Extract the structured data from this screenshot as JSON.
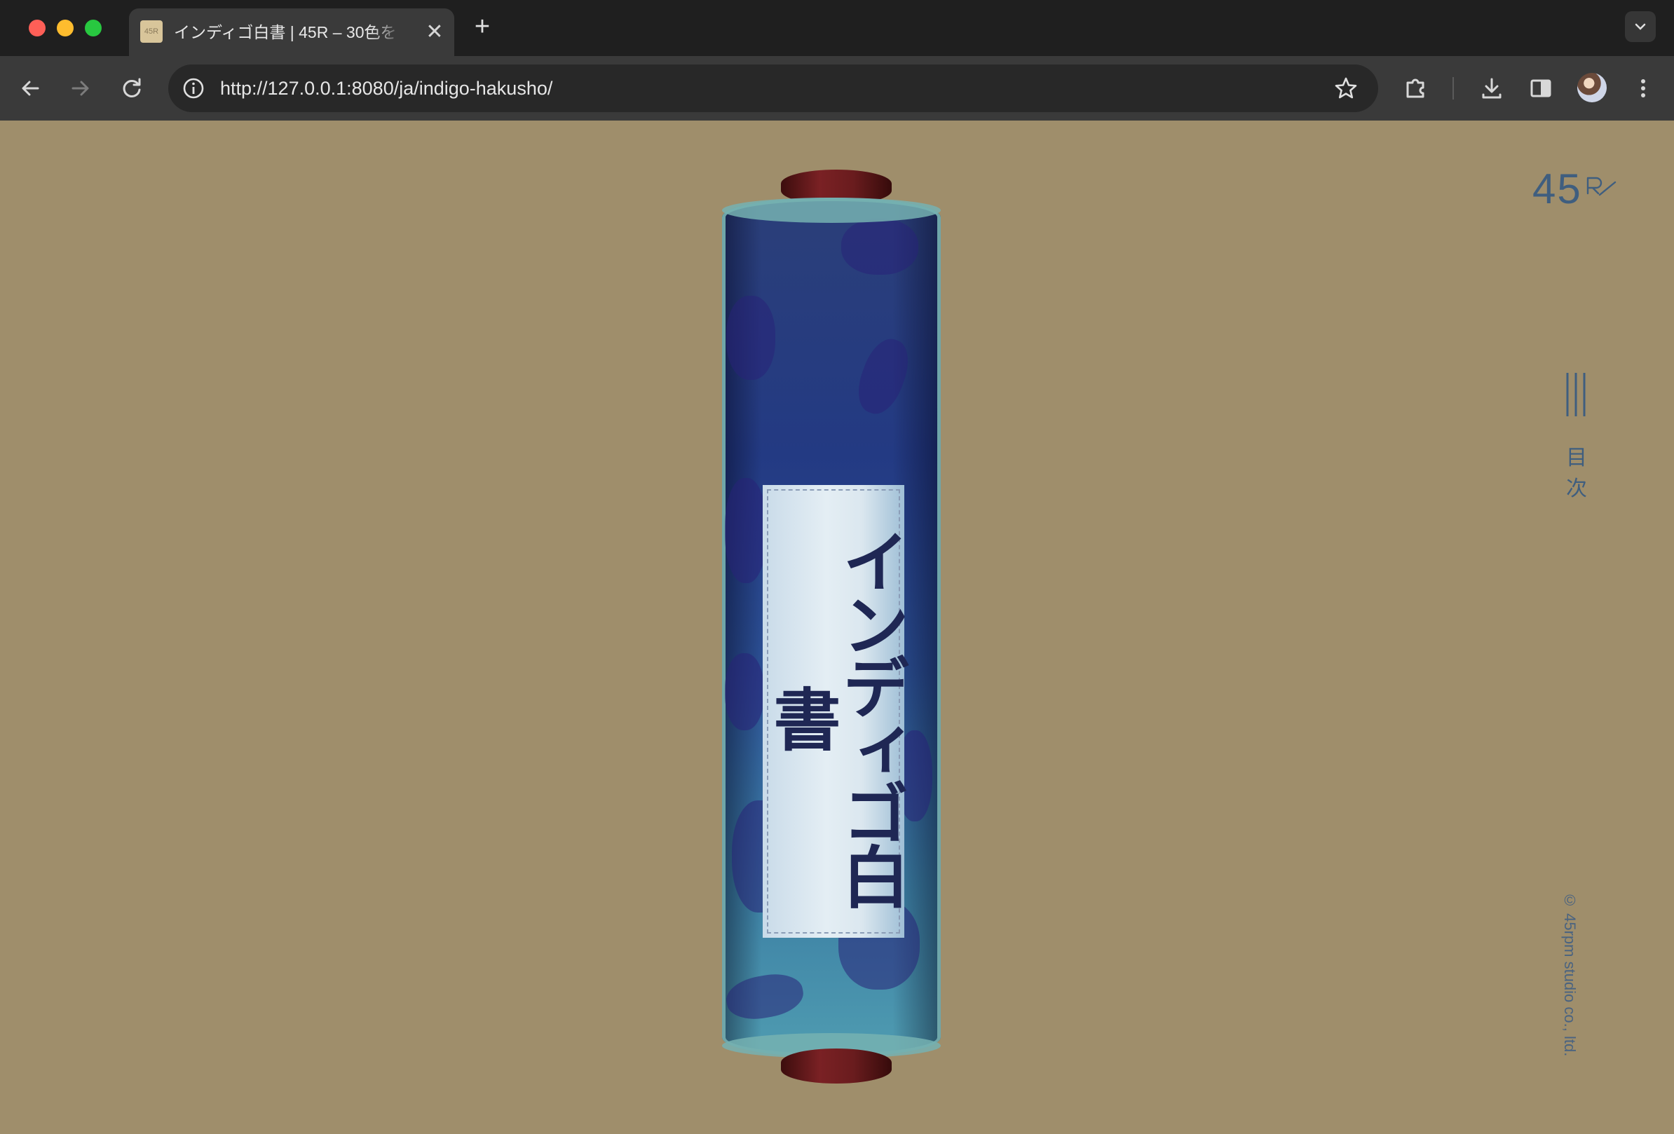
{
  "browser": {
    "tab": {
      "title": "インディゴ白書 | 45R – 30色を",
      "favicon_text": "45R",
      "close_glyph": "✕"
    },
    "new_tab_glyph": "+",
    "url": "http://127.0.0.1:8080/ja/indigo-hakusho/"
  },
  "page": {
    "logo": "45",
    "menu_label": "目次",
    "copyright": "© 45rpm studio co., ltd.",
    "scroll_label": "インディゴ白書"
  },
  "colors": {
    "background": "#9f8e6b",
    "accent_text": "#3f5e7f",
    "scroll_indigo": "#233a83",
    "roller": "#6a1c1e"
  },
  "icons": {
    "back": "arrow-left-icon",
    "forward": "arrow-right-icon",
    "reload": "reload-icon",
    "info": "info-icon",
    "bookmark": "star-icon",
    "extensions": "puzzle-icon",
    "download": "download-icon",
    "sidepanel": "side-panel-icon",
    "profile": "avatar-icon",
    "menu": "kebab-menu-icon",
    "tab_list": "chevron-down-icon",
    "site_menu": "hamburger-lines-icon"
  }
}
